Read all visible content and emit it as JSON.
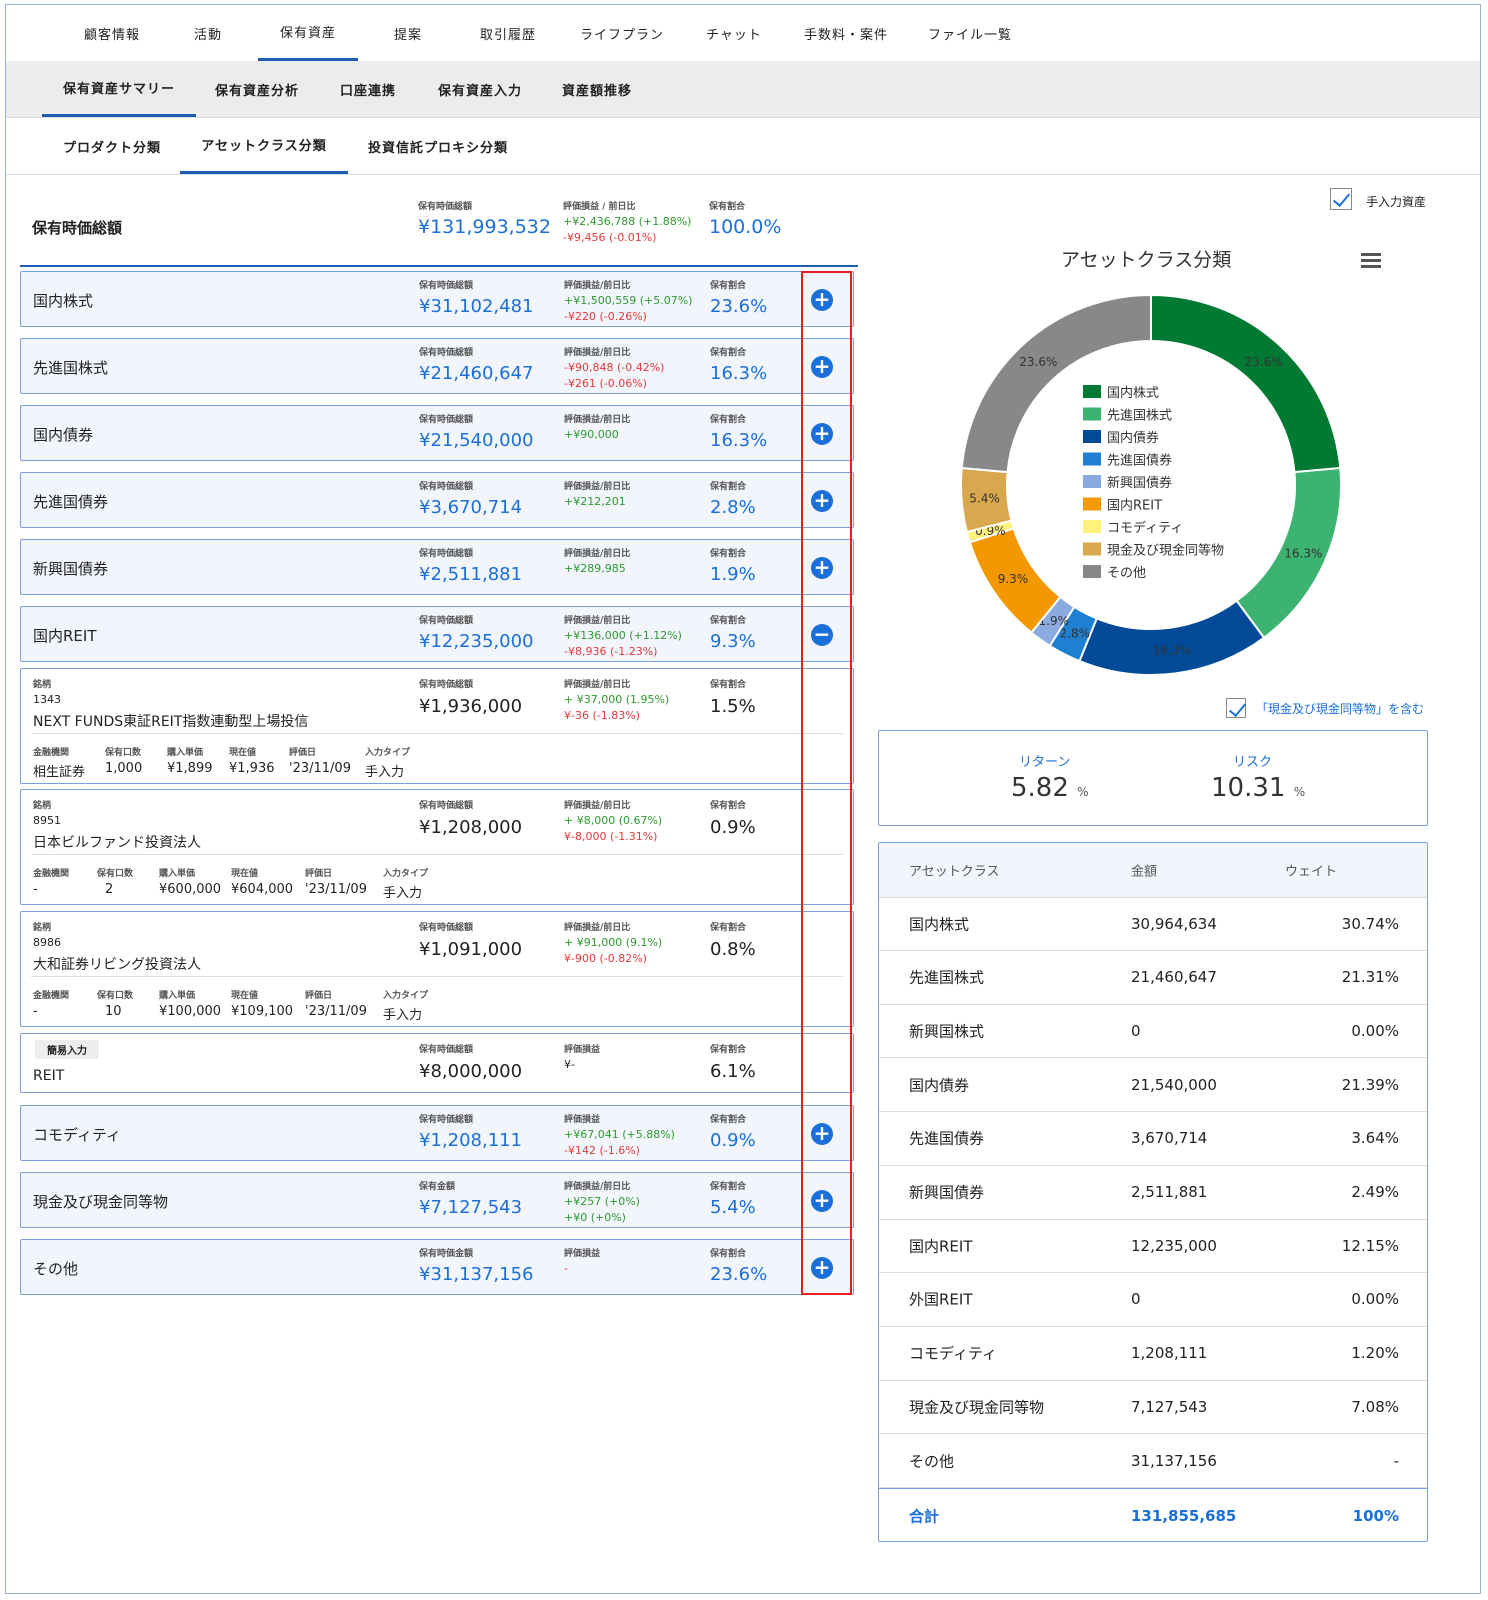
{
  "nav": {
    "top": [
      "顧客情報",
      "活動",
      "保有資産",
      "提案",
      "取引履歴",
      "ライフプラン",
      "チャット",
      "手数料・案件",
      "ファイル一覧"
    ],
    "second": [
      "保有資産サマリー",
      "保有資産分析",
      "口座連携",
      "保有資産入力",
      "資産額推移"
    ],
    "third": [
      "プロダクト分類",
      "アセットクラス分類",
      "投資信託プロキシ分類"
    ]
  },
  "total": {
    "label": "保有時価総額",
    "cap_amount": "保有時価総額",
    "amount": "¥131,993,532",
    "cap_pl": "評価損益 / 前日比",
    "pl1": "+¥2,436,788 (+1.88%)",
    "pl2": "-¥9,456 (-0.01%)",
    "cap_pct": "保有割合",
    "pct": "100.0%"
  },
  "rows": [
    {
      "name": "国内株式",
      "cap_amount": "保有時価総額",
      "amount": "¥31,102,481",
      "cap_pl": "評価損益/前日比",
      "pl1": "+¥1,500,559 (+5.07%)",
      "pl2": "-¥220 (-0.26%)",
      "cap_pct": "保有割合",
      "pct": "23.6%"
    },
    {
      "name": "先進国株式",
      "cap_amount": "保有時価総額",
      "amount": "¥21,460,647",
      "cap_pl": "評価損益/前日比",
      "pl1": "-¥90,848 (-0.42%)",
      "pl2": "-¥261 (-0.06%)",
      "cap_pct": "保有割合",
      "pct": "16.3%"
    },
    {
      "name": "国内債券",
      "cap_amount": "保有時価総額",
      "amount": "¥21,540,000",
      "cap_pl": "評価損益/前日比",
      "pl1": "+¥90,000",
      "pl2": "",
      "cap_pct": "保有割合",
      "pct": "16.3%"
    },
    {
      "name": "先進国債券",
      "cap_amount": "保有時価総額",
      "amount": "¥3,670,714",
      "cap_pl": "評価損益/前日比",
      "pl1": "+¥212,201",
      "pl2": "",
      "cap_pct": "保有割合",
      "pct": "2.8%"
    },
    {
      "name": "新興国債券",
      "cap_amount": "保有時価総額",
      "amount": "¥2,511,881",
      "cap_pl": "評価損益/前日比",
      "pl1": "+¥289,985",
      "pl2": "",
      "cap_pct": "保有割合",
      "pct": "1.9%"
    },
    {
      "name": "国内REIT",
      "cap_amount": "保有時価総額",
      "amount": "¥12,235,000",
      "cap_pl": "評価損益/前日比",
      "pl1": "+¥136,000 (+1.12%)",
      "pl2": "-¥8,936 (-1.23%)",
      "cap_pct": "保有割合",
      "pct": "9.3%"
    }
  ],
  "holdings": [
    {
      "cap_name": "銘柄",
      "code": "1343",
      "name": "NEXT FUNDS東証REIT指数連動型上場投信",
      "cap_amount": "保有時価総額",
      "amount": "¥1,936,000",
      "cap_pl": "評価損益/前日比",
      "pl1": "+ ¥37,000 (1.95%)",
      "pl2": "¥-36 (-1.83%)",
      "cap_pct": "保有割合",
      "pct": "1.5%",
      "caps": [
        "金融機関",
        "保有口数",
        "購入単価",
        "現在値",
        "評価日",
        "入力タイプ"
      ],
      "vals": [
        "相生証券",
        "1,000",
        "¥1,899",
        "¥1,936",
        "'23/11/09",
        "手入力"
      ]
    },
    {
      "cap_name": "銘柄",
      "code": "8951",
      "name": "日本ビルファンド投資法人",
      "cap_amount": "保有時価総額",
      "amount": "¥1,208,000",
      "cap_pl": "評価損益/前日比",
      "pl1": "+ ¥8,000 (0.67%)",
      "pl2": "¥-8,000 (-1.31%)",
      "cap_pct": "保有割合",
      "pct": "0.9%",
      "caps": [
        "金融機関",
        "保有口数",
        "購入単価",
        "現在値",
        "評価日",
        "入力タイプ"
      ],
      "vals": [
        "-",
        "2",
        "¥600,000",
        "¥604,000",
        "'23/11/09",
        "手入力"
      ]
    },
    {
      "cap_name": "銘柄",
      "code": "8986",
      "name": "大和証券リビング投資法人",
      "cap_amount": "保有時価総額",
      "amount": "¥1,091,000",
      "cap_pl": "評価損益/前日比",
      "pl1": "+ ¥91,000 (9.1%)",
      "pl2": "¥-900 (-0.82%)",
      "cap_pct": "保有割合",
      "pct": "0.8%",
      "caps": [
        "金融機関",
        "保有口数",
        "購入単価",
        "現在値",
        "評価日",
        "入力タイプ"
      ],
      "vals": [
        "-",
        "10",
        "¥100,000",
        "¥109,100",
        "'23/11/09",
        "手入力"
      ]
    }
  ],
  "simple": {
    "badge": "簡易入力",
    "name": "REIT",
    "cap_amount": "保有時価総額",
    "amount": "¥8,000,000",
    "cap_pl": "評価損益",
    "pl1": "¥-",
    "cap_pct": "保有割合",
    "pct": "6.1%"
  },
  "rows2": [
    {
      "name": "コモディティ",
      "cap_amount": "保有時価総額",
      "amount": "¥1,208,111",
      "cap_pl": "評価損益",
      "pl1": "+¥67,041 (+5.88%)",
      "pl2": "-¥142 (-1.6%)",
      "cap_pct": "保有割合",
      "pct": "0.9%"
    },
    {
      "name": "現金及び現金同等物",
      "cap_amount": "保有金額",
      "amount": "¥7,127,543",
      "cap_pl": "評価損益/前日比",
      "pl1": "+¥257 (+0%)",
      "pl2": "+¥0 (+0%)",
      "cap_pct": "保有割合",
      "pct": "5.4%"
    },
    {
      "name": "その他",
      "cap_amount": "保有時価金額",
      "amount": "¥31,137,156",
      "cap_pl": "評価損益",
      "pl1": "-",
      "pl2": "",
      "cap_pct": "保有割合",
      "pct": "23.6%"
    }
  ],
  "manual_label": "手入力資産",
  "chart_data": {
    "type": "pie",
    "title": "アセットクラス分類",
    "categories": [
      "国内株式",
      "先進国株式",
      "国内債券",
      "先進国債券",
      "新興国債券",
      "国内REIT",
      "コモディティ",
      "現金及び現金同等物",
      "その他"
    ],
    "values": [
      23.6,
      16.3,
      16.3,
      2.8,
      1.9,
      9.3,
      0.9,
      5.4,
      23.6
    ],
    "labels": [
      "23.6%",
      "16.3%",
      "16.3%",
      "2.8%",
      "1.9%",
      "9.3%",
      "0.9%",
      "5.4%",
      "23.6%"
    ],
    "colors": [
      "#007a33",
      "#3cb371",
      "#004a97",
      "#1f7fd0",
      "#8aaae0",
      "#f39800",
      "#fff17a",
      "#d9a84e",
      "#888888"
    ],
    "legend_position": "center"
  },
  "include_cash_label": "「現金及び現金同等物」を含む",
  "rr": {
    "return_label": "リターン",
    "return_value": "5.82",
    "return_unit": "%",
    "risk_label": "リスク",
    "risk_value": "10.31",
    "risk_unit": "%"
  },
  "table": {
    "headers": [
      "アセットクラス",
      "金額",
      "ウェイト"
    ],
    "rows": [
      [
        "国内株式",
        "30,964,634",
        "30.74%"
      ],
      [
        "先進国株式",
        "21,460,647",
        "21.31%"
      ],
      [
        "新興国株式",
        "0",
        "0.00%"
      ],
      [
        "国内債券",
        "21,540,000",
        "21.39%"
      ],
      [
        "先進国債券",
        "3,670,714",
        "3.64%"
      ],
      [
        "新興国債券",
        "2,511,881",
        "2.49%"
      ],
      [
        "国内REIT",
        "12,235,000",
        "12.15%"
      ],
      [
        "外国REIT",
        "0",
        "0.00%"
      ],
      [
        "コモディティ",
        "1,208,111",
        "1.20%"
      ],
      [
        "現金及び現金同等物",
        "7,127,543",
        "7.08%"
      ],
      [
        "その他",
        "31,137,156",
        "-"
      ]
    ],
    "total": [
      "合計",
      "131,855,685",
      "100%"
    ]
  }
}
